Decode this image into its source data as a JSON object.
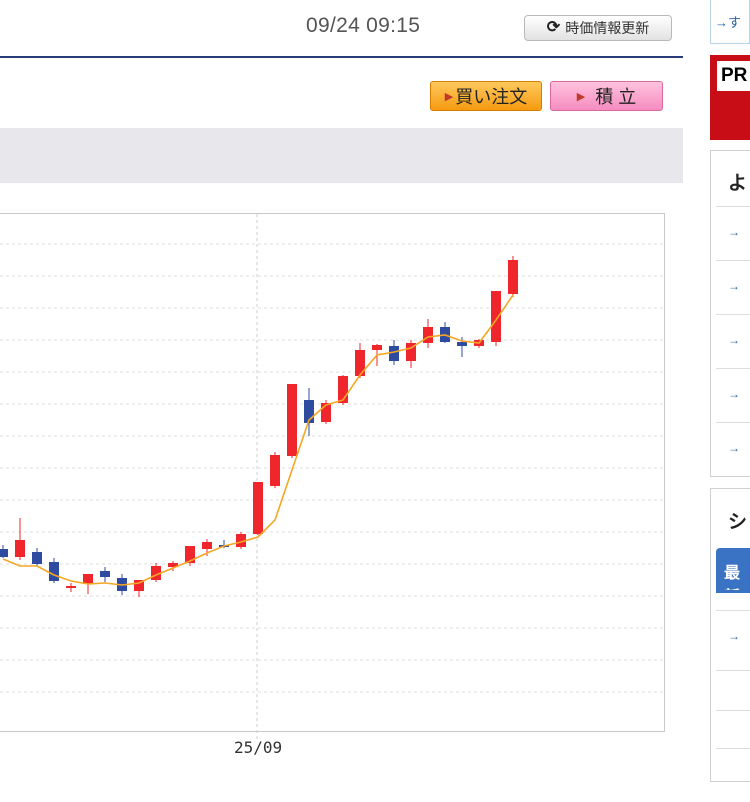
{
  "header": {
    "datetime": "09/24 09:15",
    "refresh_label": "時価情報更新",
    "refresh_icon": "refresh-icon"
  },
  "actions": {
    "buy_label": "買い注文",
    "tsumitate_label": "積 立",
    "buy_color": "#f59a11",
    "tsumitate_color": "#f58cc0"
  },
  "chart_data": {
    "type": "candlestick",
    "x_tick_labels": [
      "25/09"
    ],
    "grid": true,
    "up_color": "#f0262d",
    "down_color": "#2f4ba0",
    "ma_color": "#f5a623",
    "candles": [
      {
        "o": 549,
        "h": 545,
        "l": 558,
        "c": 557
      },
      {
        "o": 557,
        "h": 518,
        "l": 560,
        "c": 540
      },
      {
        "o": 552,
        "h": 548,
        "l": 566,
        "c": 564
      },
      {
        "o": 562,
        "h": 558,
        "l": 583,
        "c": 581
      },
      {
        "o": 588,
        "h": 583,
        "l": 592,
        "c": 586
      },
      {
        "o": 584,
        "h": 578,
        "l": 594,
        "c": 574
      },
      {
        "o": 571,
        "h": 567,
        "l": 582,
        "c": 577
      },
      {
        "o": 578,
        "h": 574,
        "l": 595,
        "c": 591
      },
      {
        "o": 591,
        "h": 583,
        "l": 597,
        "c": 580
      },
      {
        "o": 580,
        "h": 563,
        "l": 582,
        "c": 566
      },
      {
        "o": 567,
        "h": 561,
        "l": 571,
        "c": 563
      },
      {
        "o": 563,
        "h": 553,
        "l": 566,
        "c": 546
      },
      {
        "o": 549,
        "h": 539,
        "l": 556,
        "c": 542
      },
      {
        "o": 545,
        "h": 540,
        "l": 548,
        "c": 546
      },
      {
        "o": 547,
        "h": 532,
        "l": 549,
        "c": 534
      },
      {
        "o": 534,
        "h": 482,
        "l": 535,
        "c": 482
      },
      {
        "o": 486,
        "h": 452,
        "l": 488,
        "c": 455
      },
      {
        "o": 456,
        "h": 385,
        "l": 458,
        "c": 384
      },
      {
        "o": 400,
        "h": 388,
        "l": 436,
        "c": 423
      },
      {
        "o": 422,
        "h": 400,
        "l": 424,
        "c": 403
      },
      {
        "o": 403,
        "h": 375,
        "l": 405,
        "c": 376
      },
      {
        "o": 376,
        "h": 343,
        "l": 378,
        "c": 350
      },
      {
        "o": 350,
        "h": 344,
        "l": 366,
        "c": 345
      },
      {
        "o": 346,
        "h": 340,
        "l": 365,
        "c": 361
      },
      {
        "o": 361,
        "h": 340,
        "l": 368,
        "c": 343
      },
      {
        "o": 343,
        "h": 319,
        "l": 348,
        "c": 327
      },
      {
        "o": 327,
        "h": 322,
        "l": 343,
        "c": 342
      },
      {
        "o": 342,
        "h": 337,
        "l": 357,
        "c": 346
      },
      {
        "o": 346,
        "h": 339,
        "l": 348,
        "c": 340
      },
      {
        "o": 342,
        "h": 291,
        "l": 346,
        "c": 291
      },
      {
        "o": 294,
        "h": 256,
        "l": 297,
        "c": 260
      }
    ],
    "ma": [
      559,
      566,
      566,
      575,
      581,
      584,
      583,
      585,
      583,
      575,
      568,
      561,
      553,
      546,
      542,
      537,
      520,
      470,
      420,
      405,
      400,
      375,
      355,
      352,
      348,
      337,
      335,
      341,
      343,
      320,
      295
    ]
  },
  "sidebar": {
    "top_link": "→す",
    "pr_label": "PR",
    "box1_title": "よ",
    "box1_rows": [
      "→",
      "→",
      "→",
      "→",
      "→"
    ],
    "box2_title": "シ",
    "box2_tab": "最新",
    "box2_rows": [
      "→"
    ],
    "accent": "#3a72c4",
    "pr_color": "#c80d16"
  }
}
